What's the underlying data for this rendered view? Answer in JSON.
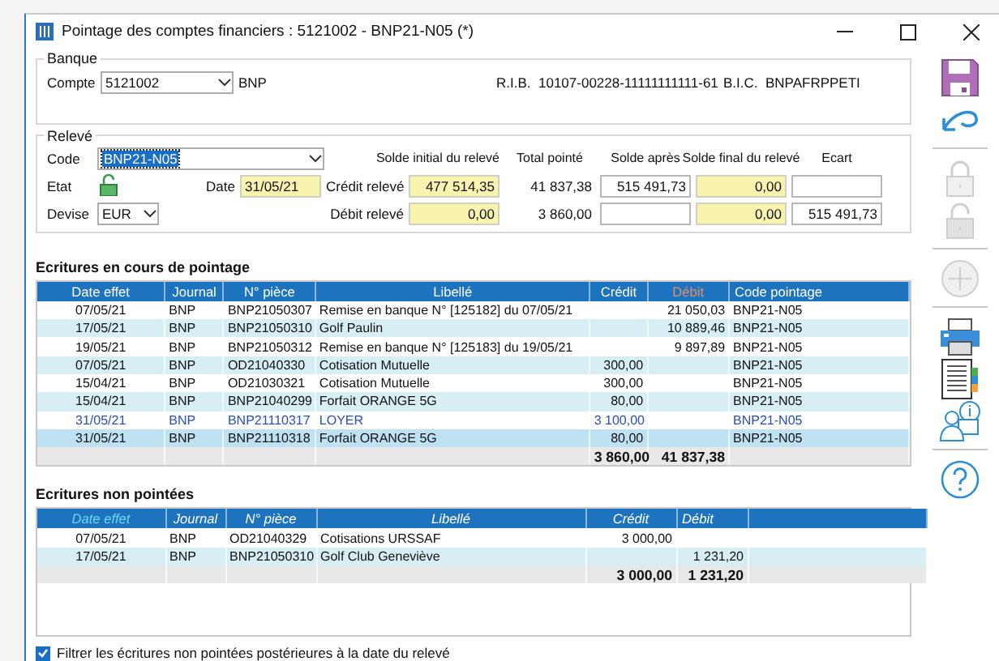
{
  "window": {
    "title": "Pointage des comptes financiers : 5121002 - BNP21-N05 (*)"
  },
  "banque": {
    "legend": "Banque",
    "compte_label": "Compte",
    "compte_value": "5121002",
    "bank_name": "BNP",
    "rib_label": "R.I.B.",
    "rib_value": "10107-00228-11111111111-61",
    "bic_label": "B.I.C.",
    "bic_value": "BNPAFRPPETI"
  },
  "releve": {
    "legend": "Relevé",
    "code_label": "Code",
    "code_value": "BNP21-N05",
    "code_focused": true,
    "etat_label": "Etat",
    "etat_locked": false,
    "date_label": "Date",
    "date_value": "31/05/21",
    "devise_label": "Devise",
    "devise_value": "EUR",
    "columns": [
      "Solde initial du relevé",
      "Total pointé",
      "Solde après",
      "Solde final du relevé",
      "Ecart"
    ],
    "lines": [
      {
        "label": "Crédit relevé",
        "cells": [
          {
            "kind": "editable",
            "value": "477 514,35"
          },
          {
            "kind": "text",
            "value": "41 837,38"
          },
          {
            "kind": "field",
            "value": "515 491,73"
          },
          {
            "kind": "editable",
            "value": "0,00"
          },
          {
            "kind": "field"
          }
        ]
      },
      {
        "label": "Débit relevé",
        "cells": [
          {
            "kind": "editable",
            "value": "0,00"
          },
          {
            "kind": "text",
            "value": "3 860,00"
          },
          {
            "kind": "field"
          },
          {
            "kind": "editable",
            "value": "0,00"
          },
          {
            "kind": "field",
            "value": "515 491,73"
          }
        ]
      }
    ]
  },
  "pointage": {
    "title": "Ecritures en cours de pointage",
    "columns": [
      {
        "label": "Date effet",
        "sorted": false
      },
      {
        "label": "Journal",
        "sorted": false
      },
      {
        "label": "N° pièce",
        "sorted": false
      },
      {
        "label": "Libellé",
        "sorted": false
      },
      {
        "label": "Crédit",
        "sorted": false
      },
      {
        "label": "Débit",
        "sorted": true
      },
      {
        "label": "Code pointage",
        "sorted": false
      }
    ],
    "rows": [
      {
        "cells": [
          "07/05/21",
          "BNP",
          "BNP21050307",
          "Remise en banque N° [125182] du 07/05/21",
          "",
          "21 050,03",
          "BNP21-N05"
        ],
        "emphasized": false,
        "selected": false
      },
      {
        "cells": [
          "17/05/21",
          "BNP",
          "BNP21050310",
          "Golf Paulin",
          "",
          "10 889,46",
          "BNP21-N05"
        ],
        "emphasized": false,
        "selected": false
      },
      {
        "cells": [
          "19/05/21",
          "BNP",
          "BNP21050312",
          "Remise en banque N° [125183] du 19/05/21",
          "",
          "9 897,89",
          "BNP21-N05"
        ],
        "emphasized": false,
        "selected": false
      },
      {
        "cells": [
          "07/05/21",
          "BNP",
          "OD21040330",
          "Cotisation Mutuelle",
          "300,00",
          "",
          "BNP21-N05"
        ],
        "emphasized": false,
        "selected": false
      },
      {
        "cells": [
          "15/04/21",
          "BNP",
          "OD21030321",
          "Cotisation Mutuelle",
          "300,00",
          "",
          "BNP21-N05"
        ],
        "emphasized": false,
        "selected": false
      },
      {
        "cells": [
          "15/04/21",
          "BNP",
          "BNP21040299",
          "Forfait ORANGE 5G",
          "80,00",
          "",
          "BNP21-N05"
        ],
        "emphasized": false,
        "selected": false
      },
      {
        "cells": [
          "31/05/21",
          "BNP",
          "BNP21110317",
          "LOYER",
          "3 100,00",
          "",
          "BNP21-N05"
        ],
        "emphasized": true,
        "selected": false
      },
      {
        "cells": [
          "31/05/21",
          "BNP",
          "BNP21110318",
          "Forfait ORANGE 5G",
          "80,00",
          "",
          "BNP21-N05"
        ],
        "emphasized": false,
        "selected": true
      }
    ],
    "totals": {
      "credit": "3 860,00",
      "debit": "41 837,38"
    }
  },
  "non_pointees": {
    "title": "Ecritures non pointées",
    "columns": [
      {
        "label": "Date effet",
        "sorted": true
      },
      {
        "label": "Journal",
        "sorted": false
      },
      {
        "label": "N° pièce",
        "sorted": false
      },
      {
        "label": "Libellé",
        "sorted": false
      },
      {
        "label": "Crédit",
        "sorted": false
      },
      {
        "label": "Débit",
        "sorted": false
      }
    ],
    "rows": [
      {
        "cells": [
          "07/05/21",
          "BNP",
          "OD21040329",
          "Cotisations URSSAF",
          "3 000,00",
          ""
        ],
        "emphasized": false,
        "selected": false
      },
      {
        "cells": [
          "17/05/21",
          "BNP",
          "BNP21050310",
          "Golf Club Geneviève",
          "",
          "1 231,20"
        ],
        "emphasized": false,
        "selected": false
      }
    ],
    "totals": {
      "credit": "3 000,00",
      "debit": "1 231,20"
    }
  },
  "filter": {
    "label": "Filtrer les écritures non pointées postérieures à la date du relevé",
    "checked": true
  },
  "toolbar": [
    [
      {
        "kind": "save",
        "disabled": false
      },
      {
        "kind": "undo",
        "disabled": false
      }
    ],
    [
      {
        "kind": "lock",
        "disabled": true
      },
      {
        "kind": "unlock",
        "disabled": true
      }
    ],
    [
      {
        "kind": "add",
        "disabled": true
      }
    ],
    [
      {
        "kind": "print",
        "disabled": false
      },
      {
        "kind": "list",
        "disabled": false
      },
      {
        "kind": "userinfo",
        "disabled": false
      }
    ],
    [
      {
        "kind": "help",
        "disabled": false
      }
    ]
  ]
}
